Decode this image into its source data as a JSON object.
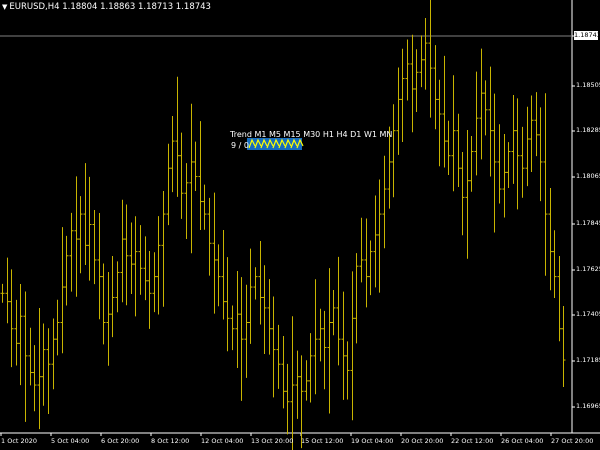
{
  "header": {
    "symbol_info": "EURUSD,H4  1.18804 1.18863 1.18713 1.18743"
  },
  "price_axis": {
    "labels": [
      "1.18743",
      "1.18505",
      "1.18285",
      "1.18065",
      "1.17845",
      "1.17625",
      "1.17405",
      "1.17185",
      "1.16965"
    ],
    "current_price": "1.18743"
  },
  "time_axis": {
    "labels": [
      "1 Oct 2020",
      "5 Oct 04:00",
      "6 Oct 20:00",
      "8 Oct 12:00",
      "12 Oct 04:00",
      "13 Oct 20:00",
      "15 Oct 12:00",
      "19 Oct 04:00",
      "20 Oct 20:00",
      "22 Oct 12:00",
      "26 Oct 04:00",
      "27 Oct 20:00"
    ]
  },
  "trend_indicator": {
    "title": "Trend",
    "timeframes": [
      "M1",
      "M5",
      "M15",
      "M30",
      "H1",
      "H4",
      "D1",
      "W1",
      "MN"
    ],
    "counts": "9 / 0",
    "arrow_color": "#ffff00",
    "band_color": "#1e90ff"
  },
  "colors": {
    "background": "#000000",
    "bars": "#c8b400",
    "axis": "#ffffff",
    "current_price_line": "#808080"
  },
  "chart_data": {
    "type": "ohlc",
    "symbol": "EURUSD",
    "timeframe": "H4",
    "ylim": [
      1.1685,
      1.1885
    ],
    "current": {
      "open": 1.18804,
      "high": 1.18863,
      "low": 1.18713,
      "close": 1.18743
    },
    "closes": [
      1.1752,
      1.1748,
      1.1735,
      1.1728,
      1.1741,
      1.1722,
      1.1714,
      1.1708,
      1.1712,
      1.1725,
      1.1718,
      1.173,
      1.1738,
      1.1755,
      1.177,
      1.1782,
      1.1778,
      1.179,
      1.1775,
      1.1785,
      1.1768,
      1.176,
      1.1738,
      1.1742,
      1.175,
      1.1762,
      1.1778,
      1.177,
      1.1766,
      1.1772,
      1.1764,
      1.1758,
      1.1752,
      1.176,
      1.1775,
      1.179,
      1.1812,
      1.1825,
      1.1818,
      1.18,
      1.1805,
      1.1815,
      1.1808,
      1.1796,
      1.179,
      1.1776,
      1.1768,
      1.176,
      1.1748,
      1.174,
      1.1735,
      1.1742,
      1.173,
      1.1738,
      1.1755,
      1.176,
      1.175,
      1.1745,
      1.1735,
      1.1725,
      1.1718,
      1.1705,
      1.17,
      1.1708,
      1.1712,
      1.1705,
      1.171,
      1.1722,
      1.173,
      1.1735,
      1.1726,
      1.1738,
      1.1745,
      1.173,
      1.1722,
      1.1715,
      1.174,
      1.1765,
      1.1768,
      1.176,
      1.1772,
      1.178,
      1.179,
      1.1802,
      1.1815,
      1.183,
      1.1845,
      1.1855,
      1.1862,
      1.185,
      1.1858,
      1.1864,
      1.1872,
      1.186,
      1.1845,
      1.1838,
      1.1825,
      1.1818,
      1.183,
      1.1812,
      1.1798,
      1.1806,
      1.182,
      1.1836,
      1.1848,
      1.184,
      1.183,
      1.1815,
      1.1802,
      1.181,
      1.182,
      1.183,
      1.1818,
      1.1812,
      1.1826,
      1.1835,
      1.1828,
      1.1815,
      1.179,
      1.1772,
      1.176,
      1.1735,
      1.172
    ]
  }
}
